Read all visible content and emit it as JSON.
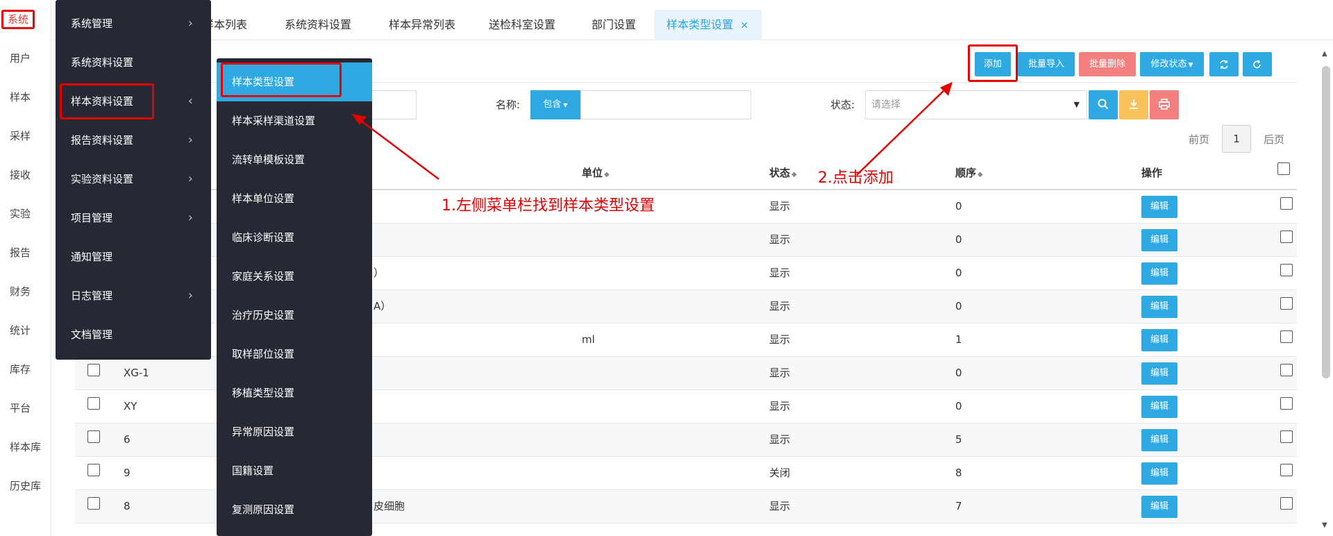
{
  "left_nav": [
    "系统",
    "用户",
    "样本",
    "采样",
    "接收",
    "实验",
    "报告",
    "财务",
    "统计",
    "库存",
    "平台",
    "样本库",
    "历史库"
  ],
  "tabs": [
    {
      "label": "样本列表"
    },
    {
      "label": "系统资料设置"
    },
    {
      "label": "样本异常列表"
    },
    {
      "label": "送检科室设置"
    },
    {
      "label": "部门设置"
    },
    {
      "label": "样本类型设置",
      "close": "×"
    }
  ],
  "toolbar": {
    "add": "添加",
    "batch_import": "批量导入",
    "batch_delete": "批量删除",
    "modify_status": "修改状态"
  },
  "filters": {
    "name_label": "名称:",
    "contains": "包含",
    "status_label": "状态:",
    "status_placeholder": "请选择"
  },
  "pager": {
    "prev": "前页",
    "page": "1",
    "next": "后页"
  },
  "table": {
    "headers": {
      "unit": "单位",
      "status": "状态",
      "order": "顺序",
      "action": "操作"
    },
    "rows": [
      {
        "code": "",
        "name": "",
        "unit": "",
        "status": "显示",
        "order": "0"
      },
      {
        "code": "",
        "name": "",
        "unit": "",
        "status": "显示",
        "order": "0"
      },
      {
        "code": "",
        "name": "）",
        "unit": "",
        "status": "显示",
        "order": "0"
      },
      {
        "code": "",
        "name": "A）",
        "unit": "",
        "status": "显示",
        "order": "0"
      },
      {
        "code": "",
        "name": "",
        "unit": "ml",
        "status": "显示",
        "order": "1"
      },
      {
        "code": "XG-1",
        "name": "",
        "unit": "",
        "status": "显示",
        "order": "0"
      },
      {
        "code": "XY",
        "name": "",
        "unit": "",
        "status": "显示",
        "order": "0"
      },
      {
        "code": "6",
        "name": "",
        "unit": "",
        "status": "显示",
        "order": "5"
      },
      {
        "code": "9",
        "name": "",
        "unit": "",
        "status": "关闭",
        "order": "8"
      },
      {
        "code": "8",
        "name": "皮细胞",
        "unit": "",
        "status": "显示",
        "order": "7"
      }
    ],
    "edit_label": "编辑"
  },
  "menu1": [
    {
      "label": "系统管理",
      "chevron": "›"
    },
    {
      "label": "系统资料设置",
      "chevron": ""
    },
    {
      "label": "样本资料设置",
      "chevron": "‹"
    },
    {
      "label": "报告资料设置",
      "chevron": "›"
    },
    {
      "label": "实验资料设置",
      "chevron": "›"
    },
    {
      "label": "项目管理",
      "chevron": "›"
    },
    {
      "label": "通知管理",
      "chevron": ""
    },
    {
      "label": "日志管理",
      "chevron": "›"
    },
    {
      "label": "文档管理",
      "chevron": ""
    }
  ],
  "menu2": [
    "样本类型设置",
    "样本采样渠道设置",
    "流转单模板设置",
    "样本单位设置",
    "临床诊断设置",
    "家庭关系设置",
    "治疗历史设置",
    "取样部位设置",
    "移植类型设置",
    "异常原因设置",
    "国籍设置",
    "复测原因设置"
  ],
  "annotations": {
    "step1": "1.左侧菜单栏找到样本类型设置",
    "step2": "2.点击添加"
  },
  "colors": {
    "accent": "#2ea9e1",
    "annotation": "#e60000",
    "menu_bg": "#262933"
  }
}
